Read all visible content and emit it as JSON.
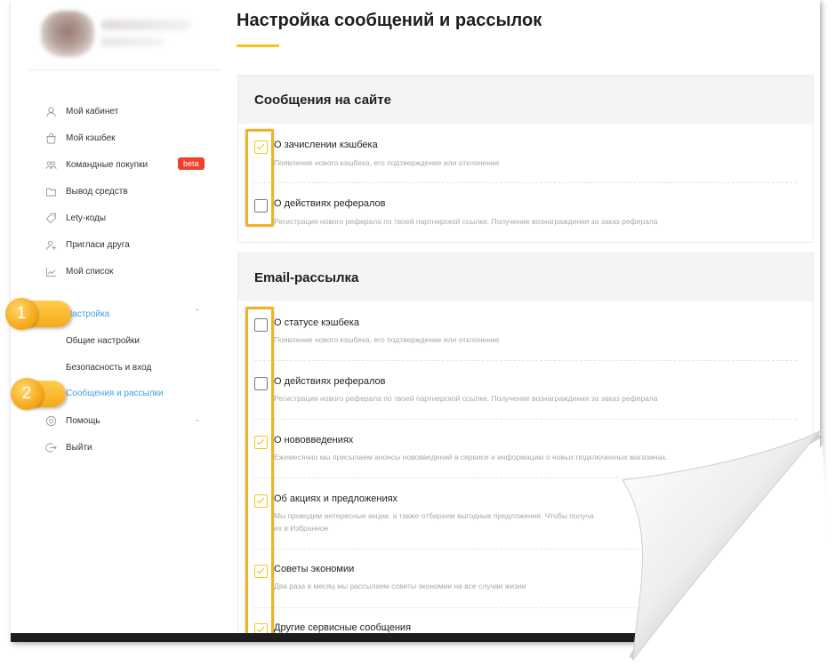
{
  "page": {
    "title": "Настройка сообщений и рассылок"
  },
  "sidebar": {
    "items": [
      {
        "label": "Мой кабинет",
        "icon": "user-icon"
      },
      {
        "label": "Мой кэшбек",
        "icon": "bag-icon"
      },
      {
        "label": "Командные покупки",
        "icon": "group-icon",
        "badge": "beta"
      },
      {
        "label": "Вывод средств",
        "icon": "folder-icon"
      },
      {
        "label": "Lety-коды",
        "icon": "tag-icon"
      },
      {
        "label": "Пригласи друга",
        "icon": "add-user-icon"
      },
      {
        "label": "Мой список",
        "icon": "chart-icon"
      }
    ],
    "settings": {
      "label": "Настройка",
      "sub_items": [
        "Общие настройки",
        "Безопасность и вход",
        "Сообщения и рассылки"
      ],
      "active_sub": "Сообщения и рассылки"
    },
    "help": "Помощь",
    "logout": "Выйти"
  },
  "callouts": [
    "1",
    "2"
  ],
  "sections": [
    {
      "title": "Сообщения на сайте",
      "rows": [
        {
          "title": "О зачислении кэшбека",
          "desc": "Появление нового кэшбека, его подтверждение или отклонение",
          "checked": true
        },
        {
          "title": "О действиях рефералов",
          "desc": "Регистрация нового реферала по твоей партнерской ссылке. Получение вознаграждения за заказ реферала",
          "checked": false
        }
      ]
    },
    {
      "title": "Email-рассылка",
      "rows": [
        {
          "title": "О статусе кэшбека",
          "desc": "Появление нового кэшбека, его подтверждение или отклонение",
          "checked": false
        },
        {
          "title": "О действиях рефералов",
          "desc": "Регистрация нового реферала по твоей партнерской ссылке. Получение вознаграждения за заказ реферала",
          "checked": false
        },
        {
          "title": "О нововведениях",
          "desc": "Ежемесячно мы присылаем анонсы нововведений в сервисе и информацию о новых подключенных магазинах.",
          "checked": true
        },
        {
          "title": "Об акциях и предложениях",
          "desc": "Мы проводим интересные акции, а также отбираем выгодные предложения. Чтобы получа",
          "desc2": "их в Избранное",
          "checked": true
        },
        {
          "title": "Советы экономии",
          "desc": "Два раза в месяц мы рассылаем советы экономии на все случаи жизни",
          "checked": true
        },
        {
          "title": "Другие сервисные сообщения",
          "desc": "",
          "checked": true
        }
      ]
    }
  ],
  "colors": {
    "accent": "#f5c518",
    "link": "#3fa1dd",
    "badge": "#f0412e",
    "highlight": "#f2b222"
  }
}
